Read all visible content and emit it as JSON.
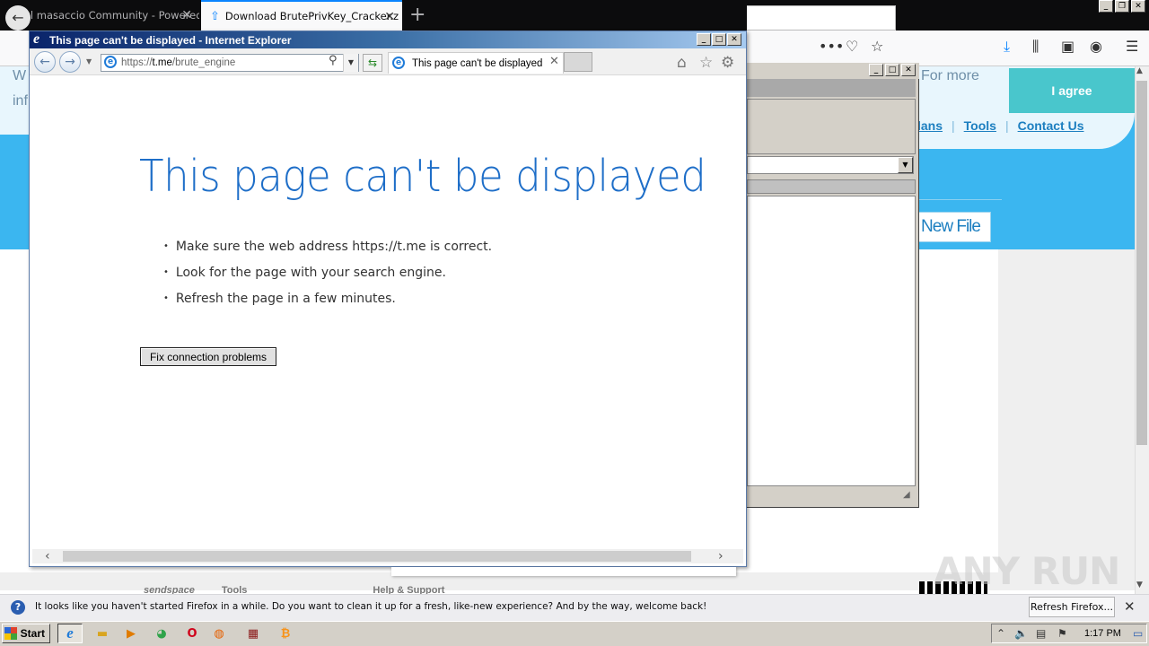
{
  "firefox": {
    "tabs": [
      {
        "label": "hotel masaccio Community - Powered b"
      },
      {
        "label": "Download BrutePrivKey_Cracker.z"
      }
    ],
    "site": {
      "frag_w": "W",
      "frag_inf": "inf",
      "cookie_text": "For more",
      "agree": "I agree",
      "nav": [
        "lans",
        "Tools",
        "Contact Us"
      ],
      "new_file": "New File",
      "footer": [
        "sendspace",
        "Tools",
        "Help & Support"
      ]
    },
    "notification": {
      "text": "It looks like you haven't started Firefox in a while. Do you want to clean it up for a fresh, like-new experience? And by the way, welcome back!",
      "button": "Refresh Firefox..."
    }
  },
  "ie": {
    "window_title": "This page can't be displayed - Internet Explorer",
    "address_prefix": "https://",
    "address_host": "t.me",
    "address_path": "/brute_engine",
    "tab_label": "This page can't be displayed",
    "heading": "This page can't be displayed",
    "bullets": [
      "Make sure the web address https://t.me is correct.",
      "Look for the page with your search engine.",
      "Refresh the page in a few minutes."
    ],
    "fix_button": "Fix connection problems"
  },
  "watermark": "ANY RUN",
  "taskbar": {
    "start": "Start",
    "clock": "1:17 PM"
  },
  "colors": {
    "ie_heading": "#1e6ec8",
    "site_header": "#3bb6f0",
    "agree_button": "#49c6cc",
    "firefox_tabstrip": "#0c0c0d"
  }
}
